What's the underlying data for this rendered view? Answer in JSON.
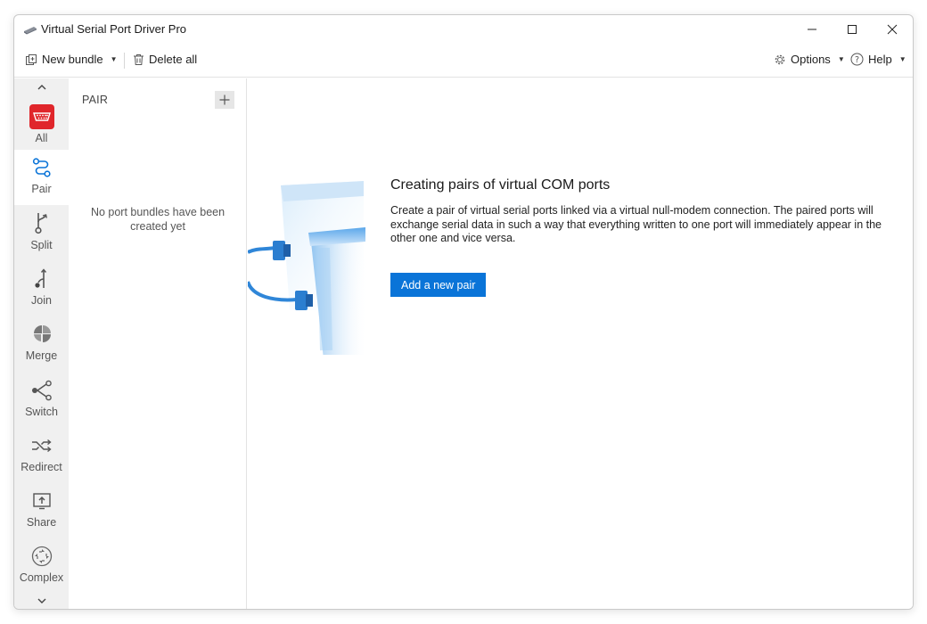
{
  "window": {
    "title": "Virtual Serial Port Driver Pro"
  },
  "toolbar": {
    "new_bundle": "New bundle",
    "delete_all": "Delete all",
    "options": "Options",
    "help": "Help"
  },
  "nav": {
    "items": [
      {
        "label": "All",
        "icon": "serial-port-icon",
        "selected": false
      },
      {
        "label": "Pair",
        "icon": "pair-icon",
        "selected": true
      },
      {
        "label": "Split",
        "icon": "split-icon",
        "selected": false
      },
      {
        "label": "Join",
        "icon": "join-icon",
        "selected": false
      },
      {
        "label": "Merge",
        "icon": "merge-icon",
        "selected": false
      },
      {
        "label": "Switch",
        "icon": "switch-icon",
        "selected": false
      },
      {
        "label": "Redirect",
        "icon": "redirect-icon",
        "selected": false
      },
      {
        "label": "Share",
        "icon": "share-icon",
        "selected": false
      },
      {
        "label": "Complex",
        "icon": "complex-icon",
        "selected": false
      }
    ]
  },
  "pair_panel": {
    "title": "PAIR",
    "empty_message": "No port bundles have been created yet"
  },
  "main": {
    "heading": "Creating pairs of virtual COM ports",
    "description": "Create a pair of virtual serial ports linked via a virtual null-modem connection. The paired ports will exchange serial data in such a way that everything written to one port will immediately appear in the other one and vice versa.",
    "button_label": "Add a new pair"
  },
  "colors": {
    "accent": "#0a74d8",
    "all_icon_red": "#e0262b",
    "nav_bg": "#f0f0f0",
    "illustration_blue": "#2f86d8"
  }
}
